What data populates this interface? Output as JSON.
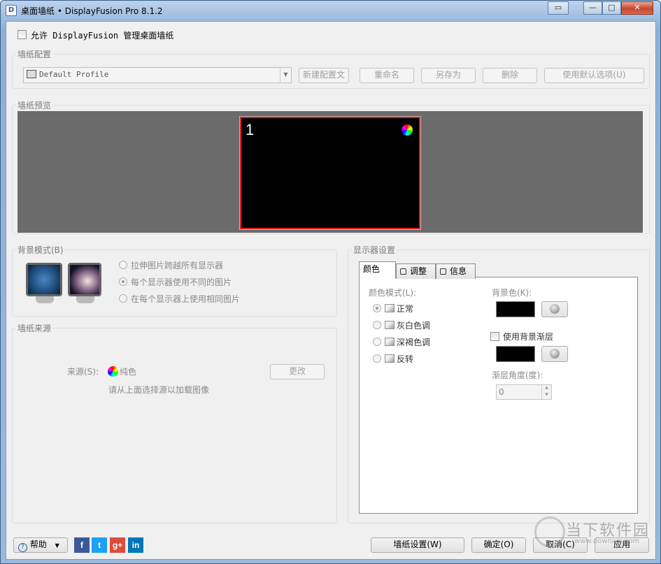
{
  "window": {
    "title": "桌面墙纸 • DisplayFusion Pro 8.1.2"
  },
  "allow_checkbox_label": "允许 DisplayFusion 管理桌面墙纸",
  "profile": {
    "group_title": "墙纸配置",
    "selected": "Default Profile",
    "buttons": {
      "new": "新建配置文",
      "rename": "重命名",
      "save_as": "另存为",
      "delete": "删除",
      "use_default": "使用默认选项(U)"
    }
  },
  "preview": {
    "group_title": "墙纸预览",
    "monitor_number": "1"
  },
  "background_mode": {
    "group_title": "背景模式(B)",
    "options": [
      "拉伸图片跨越所有显示器",
      "每个显示器使用不同的图片",
      "在每个显示器上使用相同图片"
    ]
  },
  "source": {
    "group_title": "墙纸来源",
    "label": "来源(S):",
    "value": "纯色",
    "change_button": "更改",
    "hint": "请从上面选择源以加载图像"
  },
  "monitor_settings": {
    "group_title": "显示器设置",
    "tabs": [
      "颜色",
      "调整",
      "信息"
    ],
    "color_mode_label": "颜色模式(L):",
    "color_modes": [
      "正常",
      "灰白色调",
      "深褐色调",
      "反转"
    ],
    "bg_color_label": "背景色(K):",
    "use_gradient_label": "使用背景渐层",
    "gradient_angle_label": "渐层角度(度):",
    "gradient_angle_value": "0"
  },
  "footer": {
    "help": "帮助",
    "wallpaper_settings": "墙纸设置(W)",
    "ok": "确定(O)",
    "cancel": "取消(C)",
    "apply": "应用"
  },
  "watermark": {
    "text": "当下软件园",
    "url": "www.downxia.com"
  },
  "colors": {
    "accent": "#2c5aa0",
    "preview_bg": "#6b6b6b",
    "monitor_border": "#e02020"
  }
}
